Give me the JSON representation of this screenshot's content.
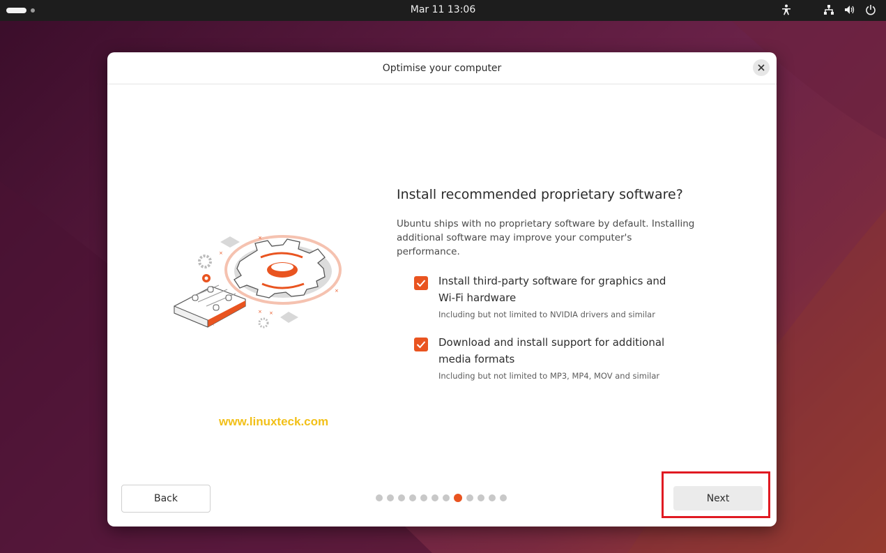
{
  "topbar": {
    "clock": "Mar 11  13:06",
    "tray_icons": [
      "accessibility-icon",
      "network-icon",
      "volume-icon",
      "power-icon"
    ]
  },
  "dialog": {
    "title": "Optimise your computer",
    "heading": "Install recommended proprietary software?",
    "description": "Ubuntu ships with no proprietary software by default. Installing additional software may improve your computer's performance.",
    "options": [
      {
        "label": "Install third-party software for graphics and Wi-Fi hardware",
        "sublabel": "Including but not limited to NVIDIA drivers and similar",
        "checked": true
      },
      {
        "label": "Download and install support for additional media formats",
        "sublabel": "Including but not limited to MP3, MP4, MOV and similar",
        "checked": true
      }
    ],
    "back_label": "Back",
    "next_label": "Next",
    "progress": {
      "total": 12,
      "current": 7
    }
  },
  "watermark": "www.linuxteck.com",
  "colors": {
    "accent": "#e95420",
    "highlight_box": "#e01a22",
    "watermark": "#f2c018"
  }
}
